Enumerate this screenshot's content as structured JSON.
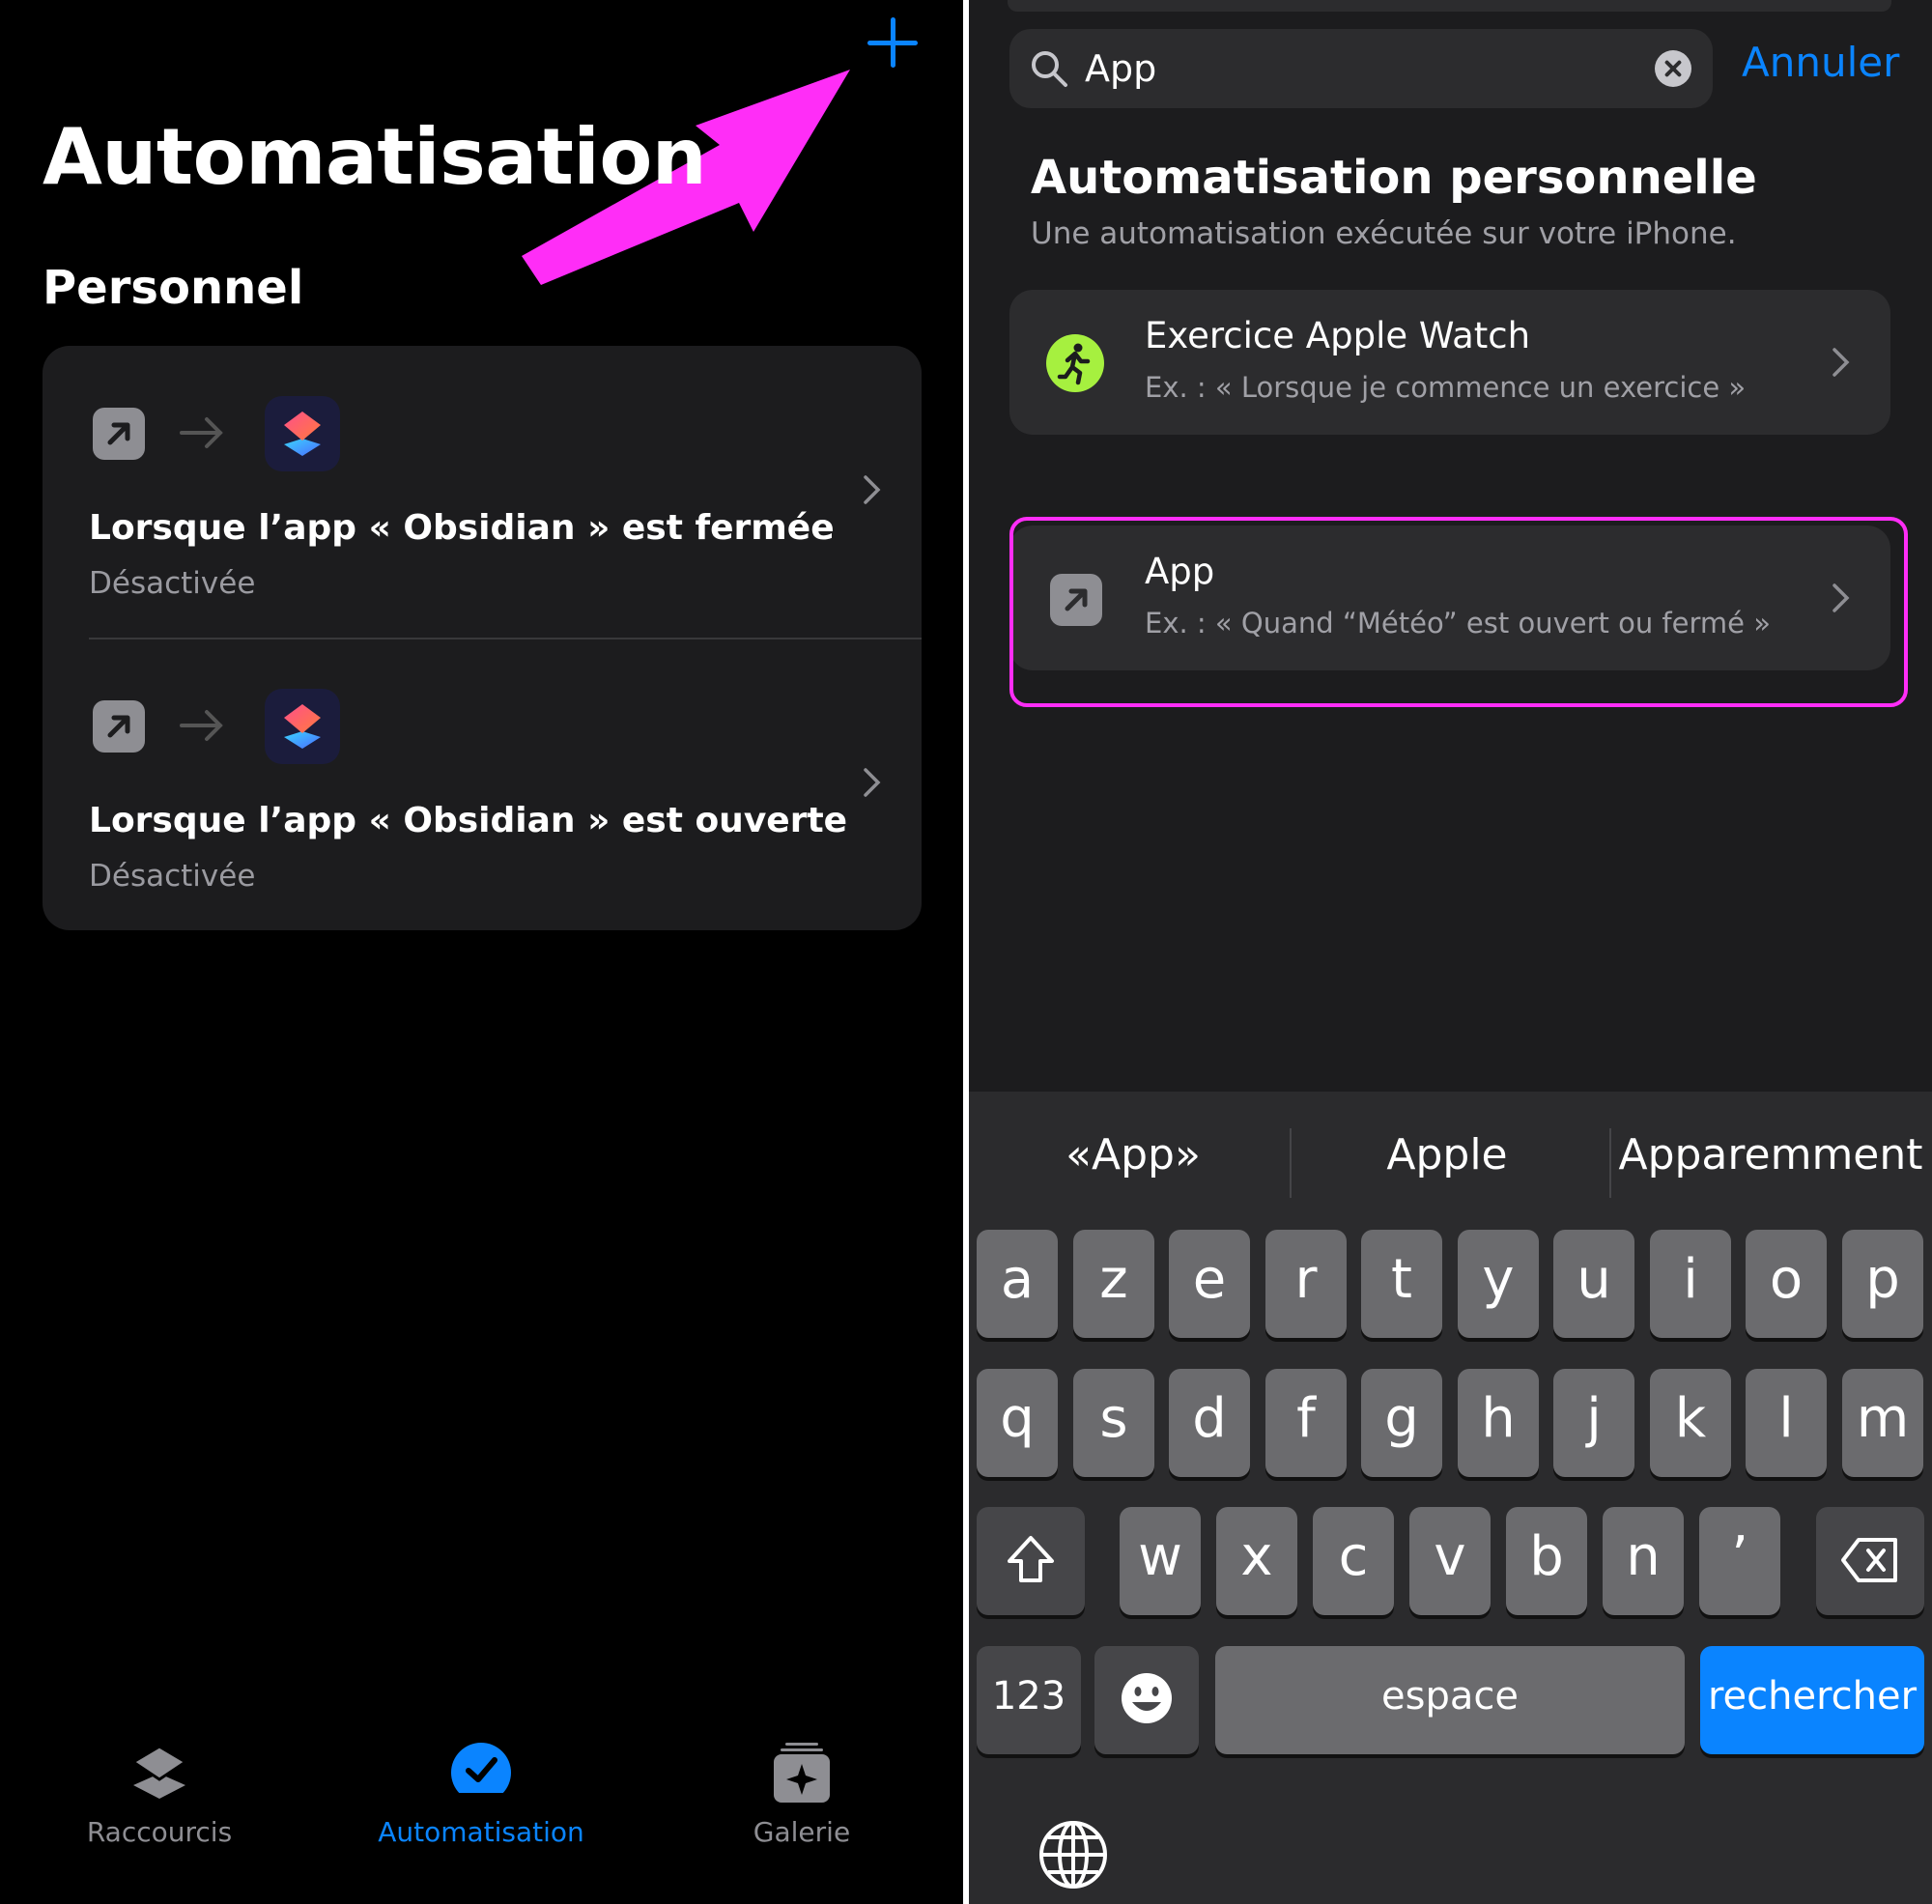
{
  "left": {
    "title": "Automatisation",
    "section": "Personnel",
    "automations": [
      {
        "title": "Lorsque l’app « Obsidian » est fermée",
        "status": "Désactivée"
      },
      {
        "title": "Lorsque l’app « Obsidian » est ouverte",
        "status": "Désactivée"
      }
    ],
    "tabs": [
      {
        "label": "Raccourcis",
        "icon": "shortcuts-stack-icon"
      },
      {
        "label": "Automatisation",
        "icon": "automation-check-icon",
        "active": true
      },
      {
        "label": "Galerie",
        "icon": "gallery-sparkle-icon"
      }
    ],
    "accent": "#0a84ff",
    "annotation_color": "#ff2df7"
  },
  "right": {
    "search": {
      "value": "App"
    },
    "cancel_label": "Annuler",
    "title": "Automatisation personnelle",
    "subtitle": "Une automatisation exécutée sur votre iPhone.",
    "options": [
      {
        "title": "Exercice Apple Watch",
        "subtitle": "Ex. : « Lorsque je commence un exercice »",
        "icon": "runner-icon"
      },
      {
        "title": "App",
        "subtitle": "Ex. : « Quand “Météo” est ouvert ou fermé »",
        "icon": "app-open-icon"
      }
    ],
    "keyboard": {
      "suggestions": [
        "«App»",
        "Apple",
        "Apparemment"
      ],
      "row1": [
        "a",
        "z",
        "e",
        "r",
        "t",
        "y",
        "u",
        "i",
        "o",
        "p"
      ],
      "row2": [
        "q",
        "s",
        "d",
        "f",
        "g",
        "h",
        "j",
        "k",
        "l",
        "m"
      ],
      "row3": [
        "w",
        "x",
        "c",
        "v",
        "b",
        "n",
        "’"
      ],
      "numbers_label": "123",
      "space_label": "espace",
      "search_label": "rechercher"
    }
  }
}
